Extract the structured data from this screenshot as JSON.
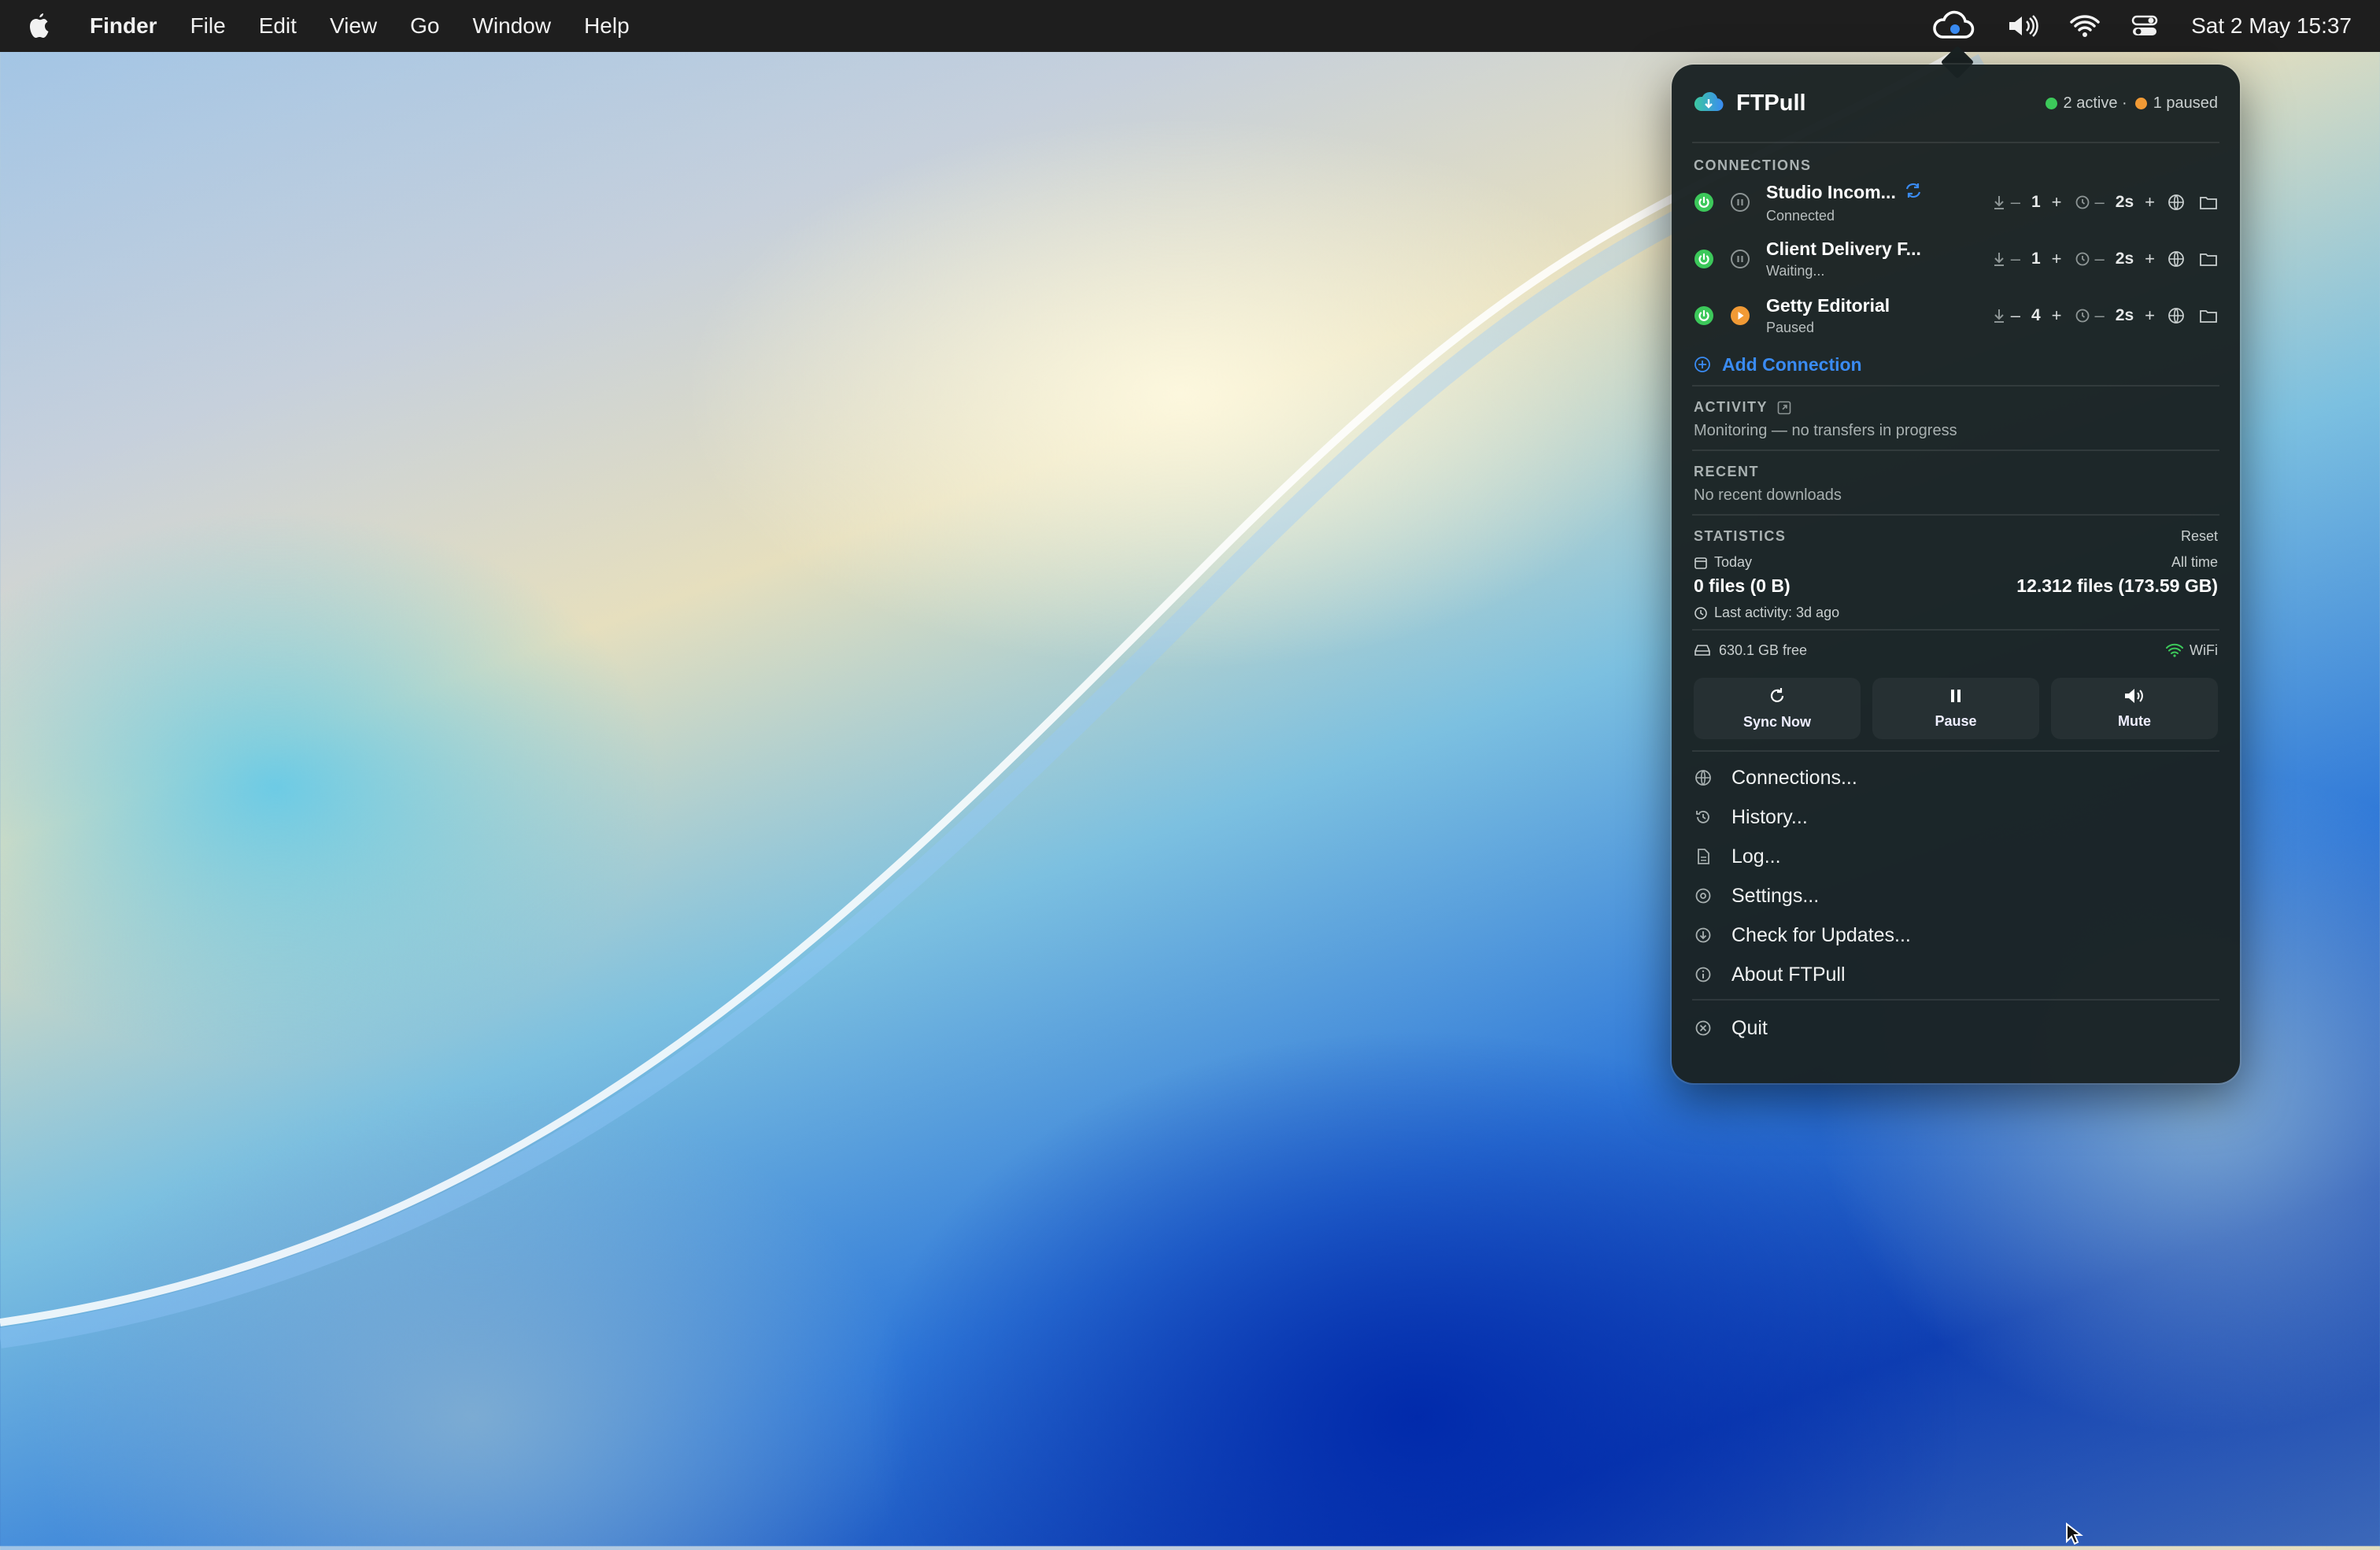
{
  "menubar": {
    "app_name": "Finder",
    "menus": [
      "File",
      "Edit",
      "View",
      "Go",
      "Window",
      "Help"
    ],
    "clock": "Sat 2 May  15:37"
  },
  "panel": {
    "title": "FTPull",
    "status_active": "2 active ·",
    "status_paused": "1 paused",
    "colors": {
      "active": "#3cc85a",
      "paused": "#f19a35",
      "link": "#3a8bf2"
    },
    "connections_label": "CONNECTIONS",
    "connections": [
      {
        "name": "Studio Incom...",
        "status": "Connected",
        "count": "1",
        "interval": "2s",
        "syncing": true,
        "state_icon": "pause-icon"
      },
      {
        "name": "Client Delivery F...",
        "status": "Waiting...",
        "count": "1",
        "interval": "2s",
        "syncing": false,
        "state_icon": "pause-icon"
      },
      {
        "name": "Getty Editorial",
        "status": "Paused",
        "count": "4",
        "interval": "2s",
        "syncing": false,
        "state_icon": "play-icon"
      }
    ],
    "minus": "–",
    "plus": "+",
    "add_connection": "Add Connection",
    "activity_label": "ACTIVITY",
    "activity_text": "Monitoring — no transfers in progress",
    "recent_label": "RECENT",
    "recent_text": "No recent downloads",
    "statistics_label": "STATISTICS",
    "reset": "Reset",
    "today_label": "Today",
    "today_value": "0 files (0 B)",
    "alltime_label": "All time",
    "alltime_value": "12.312 files (173.59 GB)",
    "last_activity": "Last activity: 3d ago",
    "disk_free": "630.1 GB free",
    "network": "WiFi",
    "buttons": {
      "sync": "Sync Now",
      "pause": "Pause",
      "mute": "Mute"
    },
    "menu": {
      "connections": "Connections...",
      "history": "History...",
      "log": "Log...",
      "settings": "Settings...",
      "updates": "Check for Updates...",
      "about": "About FTPull",
      "quit": "Quit"
    }
  }
}
